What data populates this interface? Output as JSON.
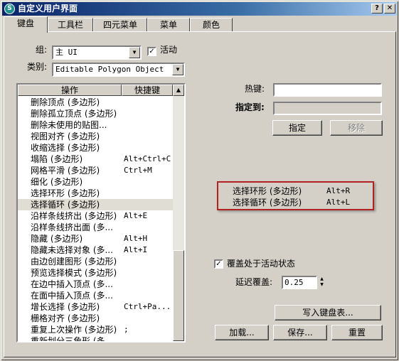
{
  "window": {
    "title": "自定义用户界面",
    "icon": "3ds-max-icon",
    "help_label": "?",
    "close_label": "✕"
  },
  "tabs": [
    {
      "label": "键盘",
      "active": true
    },
    {
      "label": "工具栏",
      "active": false
    },
    {
      "label": "四元菜单",
      "active": false
    },
    {
      "label": "菜单",
      "active": false
    },
    {
      "label": "颜色",
      "active": false
    }
  ],
  "group": {
    "label": "组:",
    "value": "主 UI",
    "active_label": "活动",
    "active_checked": true
  },
  "category": {
    "label": "类别:",
    "value": "Editable Polygon Object"
  },
  "list": {
    "col_action": "操作",
    "col_shortcut": "快捷键",
    "rows": [
      {
        "action": "删除顶点 (多边形)",
        "shortcut": ""
      },
      {
        "action": "删除孤立顶点 (多边形)",
        "shortcut": ""
      },
      {
        "action": "删除未使用的贴图...",
        "shortcut": ""
      },
      {
        "action": "视图对齐 (多边形)",
        "shortcut": ""
      },
      {
        "action": "收缩选择 (多边形)",
        "shortcut": ""
      },
      {
        "action": "塌陷 (多边形)",
        "shortcut": "Alt+Ctrl+C"
      },
      {
        "action": "网格平滑 (多边形)",
        "shortcut": "Ctrl+M"
      },
      {
        "action": "细化 (多边形)",
        "shortcut": ""
      },
      {
        "action": "选择环形 (多边形)",
        "shortcut": ""
      },
      {
        "action": "选择循环 (多边形)",
        "shortcut": "",
        "selected": true
      },
      {
        "action": "沿样条线挤出 (多边形)",
        "shortcut": "Alt+E"
      },
      {
        "action": "沿样条线挤出面 (多...",
        "shortcut": ""
      },
      {
        "action": "隐藏 (多边形)",
        "shortcut": "Alt+H"
      },
      {
        "action": "隐藏未选择对象 (多...",
        "shortcut": "Alt+I"
      },
      {
        "action": "由边创建图形 (多边形)",
        "shortcut": ""
      },
      {
        "action": "预览选择模式 (多边形)",
        "shortcut": ""
      },
      {
        "action": "在边中插入顶点 (多...",
        "shortcut": ""
      },
      {
        "action": "在面中插入顶点 (多...",
        "shortcut": ""
      },
      {
        "action": "增长选择 (多边形)",
        "shortcut": "Ctrl+Pa..."
      },
      {
        "action": "栅格对齐 (多边形)",
        "shortcut": ""
      },
      {
        "action": "重复上次操作 (多边形)",
        "shortcut": ";"
      },
      {
        "action": "重新划分三角形 (多...",
        "shortcut": ""
      }
    ]
  },
  "hotkey": {
    "label": "热键:",
    "value": ""
  },
  "assigned_to": {
    "label": "指定到:",
    "value": ""
  },
  "buttons": {
    "assign": "指定",
    "remove": "移除",
    "write_keyboard": "写入键盘表...",
    "load": "加载...",
    "save": "保存...",
    "reset": "重置"
  },
  "popup": {
    "rows": [
      {
        "action": "选择环形 (多边形)",
        "shortcut": "Alt+R"
      },
      {
        "action": "选择循环 (多边形)",
        "shortcut": "Alt+L"
      }
    ],
    "border_color": "#b22222"
  },
  "override": {
    "label": "覆盖处于活动状态",
    "checked": true
  },
  "delay": {
    "label": "延迟覆盖:",
    "value": "0.25"
  }
}
